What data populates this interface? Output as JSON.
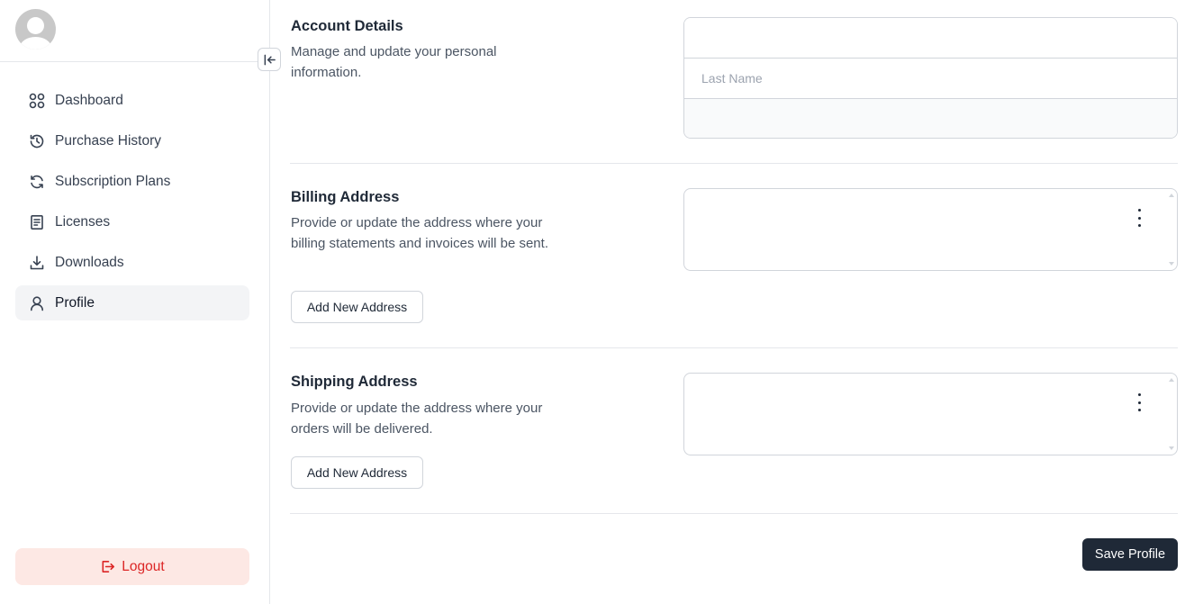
{
  "sidebar": {
    "nav": [
      {
        "label": "Dashboard",
        "icon": "dashboard-grid-icon"
      },
      {
        "label": "Purchase History",
        "icon": "history-icon"
      },
      {
        "label": "Subscription Plans",
        "icon": "refresh-icon"
      },
      {
        "label": "Licenses",
        "icon": "document-icon"
      },
      {
        "label": "Downloads",
        "icon": "download-icon"
      },
      {
        "label": "Profile",
        "icon": "user-icon",
        "active": true
      }
    ],
    "logout_label": "Logout"
  },
  "account": {
    "title": "Account Details",
    "description": "Manage and update your personal information.",
    "first_name_value": "",
    "last_name_placeholder": "Last Name",
    "email_value": ""
  },
  "billing": {
    "title": "Billing Address",
    "description": "Provide or update the address where your billing statements and invoices will be sent.",
    "add_button": "Add New Address"
  },
  "shipping": {
    "title": "Shipping Address",
    "description": "Provide or update the address where your orders will be delivered.",
    "add_button": "Add New Address"
  },
  "save_button": "Save Profile",
  "colors": {
    "accent_dark": "#1f2937",
    "logout_bg": "#fde8e4",
    "logout_text": "#dc2626",
    "active_nav_bg": "#f3f4f6"
  }
}
